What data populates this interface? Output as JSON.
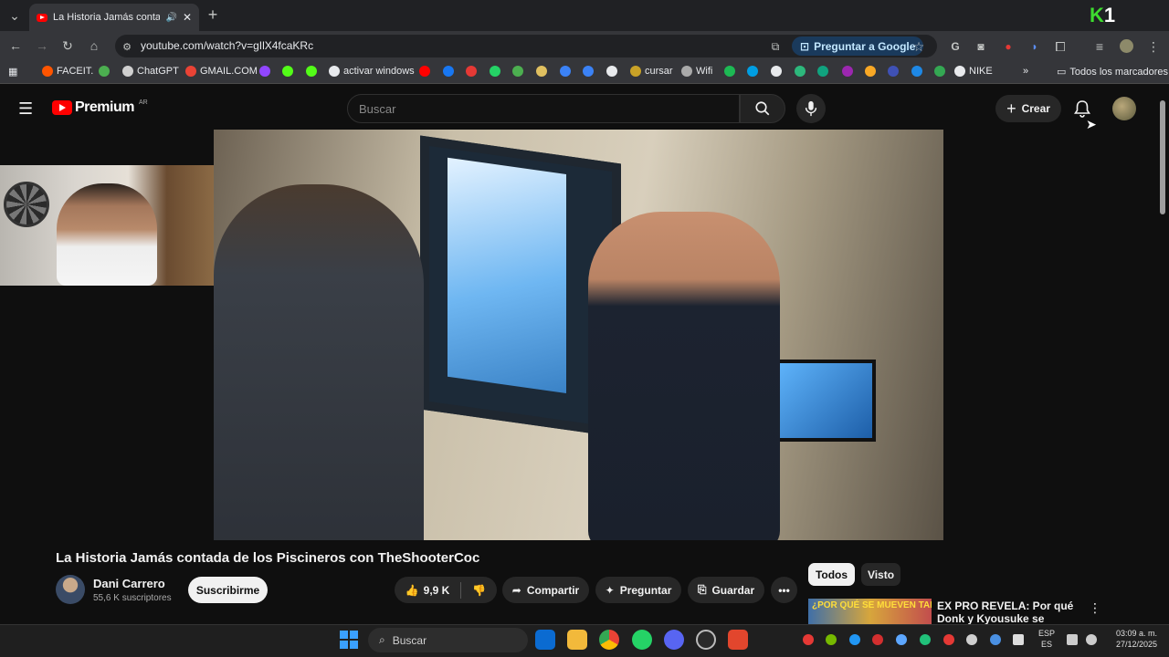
{
  "browser": {
    "tab_title": "La Historia Jamás contada d",
    "url": "youtube.com/watch?v=gIlX4fcaKRc",
    "ask_google": "Preguntar a Google",
    "all_bookmarks": "Todos los marcadores",
    "bookmarks": [
      {
        "label": "FACEIT.",
        "color": "#ff5500"
      },
      {
        "label": "",
        "color": "#4caf50"
      },
      {
        "label": "ChatGPT",
        "color": "#d0d0d0"
      },
      {
        "label": "GMAIL.COM",
        "color": "#ea4335"
      },
      {
        "label": "",
        "color": "#9146ff"
      },
      {
        "label": "",
        "color": "#53fc18"
      },
      {
        "label": "",
        "color": "#53fc18"
      },
      {
        "label": "activar windows",
        "color": "#e8eaed"
      },
      {
        "label": "",
        "color": "#ff0000"
      },
      {
        "label": "",
        "color": "#1877f2"
      },
      {
        "label": "",
        "color": "#e53935"
      },
      {
        "label": "",
        "color": "#25d366"
      },
      {
        "label": "",
        "color": "#4caf50"
      },
      {
        "label": "",
        "color": "#e0c060"
      },
      {
        "label": "",
        "color": "#3b82f6"
      },
      {
        "label": "",
        "color": "#3b82f6"
      },
      {
        "label": "",
        "color": "#e8eaed"
      },
      {
        "label": "cursar",
        "color": "#c9a227"
      },
      {
        "label": "Wifi",
        "color": "#aaaaaa"
      },
      {
        "label": "",
        "color": "#1db954"
      },
      {
        "label": "",
        "color": "#009ee3"
      },
      {
        "label": "",
        "color": "#e8eaed"
      },
      {
        "label": "",
        "color": "#2db87c"
      },
      {
        "label": "",
        "color": "#10a37f"
      },
      {
        "label": "",
        "color": "#9c27b0"
      },
      {
        "label": "",
        "color": "#f9a825"
      },
      {
        "label": "",
        "color": "#3f51b5"
      },
      {
        "label": "",
        "color": "#1e88e5"
      },
      {
        "label": "",
        "color": "#34a853"
      },
      {
        "label": "NIKE",
        "color": "#e8eaed"
      }
    ]
  },
  "youtube": {
    "logo_text": "Premium",
    "region": "AR",
    "search_placeholder": "Buscar",
    "create_label": "Crear"
  },
  "video": {
    "title": "La Historia Jamás contada de los Piscineros con TheShooterCoc",
    "channel_name": "Dani Carrero",
    "channel_subs": "55,6 K suscriptores",
    "subscribe_label": "Suscribirme",
    "likes": "9,9 K",
    "share_label": "Compartir",
    "ask_label": "Preguntar",
    "save_label": "Guardar"
  },
  "recommendations": {
    "chips": [
      "Todos",
      "Visto"
    ],
    "first": {
      "thumb_text": "¿POR QUÉ SE MUEVEN TAN BIEN?",
      "title": "EX PRO REVELA: Por qué Donk y Kyousuke se mueven como"
    }
  },
  "taskbar": {
    "search_label": "Buscar",
    "lang_top": "ESP",
    "lang_bottom": "ES",
    "time": "03:09 a. m.",
    "date": "27/12/2025"
  },
  "overlay": {
    "k": "K",
    "one": "1"
  }
}
